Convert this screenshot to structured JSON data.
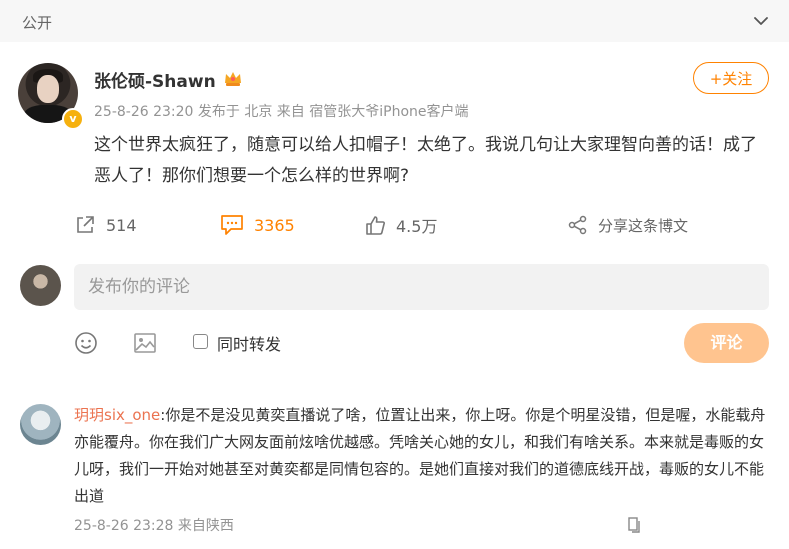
{
  "topbar": {
    "visibility": "公开",
    "chevron_icon": "chevron-down-icon"
  },
  "post": {
    "author": "张伦硕-Shawn",
    "verified_icon": "verified-badge-icon",
    "member_icon": "crown-icon",
    "meta": "25-8-26 23:20  发布于 北京  来自 宿管张大爷iPhone客户端",
    "follow_label": "+关注",
    "content": "这个世界太疯狂了，随意可以给人扣帽子！太绝了。我说几句让大家理智向善的话！成了恶人了！那你们想要一个怎么样的世界啊?"
  },
  "actions": {
    "repost_count": "514",
    "comment_count": "3365",
    "like_count": "4.5万",
    "share_label": "分享这条博文"
  },
  "comment_box": {
    "placeholder": "发布你的评论",
    "checkbox_label": "同时转发",
    "submit_label": "评论"
  },
  "comment": {
    "user": "玥玥six_one",
    "text": ":你是不是没见黄奕直播说了啥，位置让出来，你上呀。你是个明星没错，但是喔，水能载舟亦能覆舟。你在我们广大网友面前炫啥优越感。凭啥关心她的女儿，和我们有啥关系。本来就是毒贩的女儿呀，我们一开始对她甚至对黄奕都是同情包容的。是她们直接对我们的道德底线开战，毒贩的女儿不能出道",
    "meta": "25-8-26 23:28  来自陕西"
  },
  "colors": {
    "accent": "#ff8200",
    "submit_disabled": "#ffc48f",
    "username_link": "#eb7350"
  }
}
